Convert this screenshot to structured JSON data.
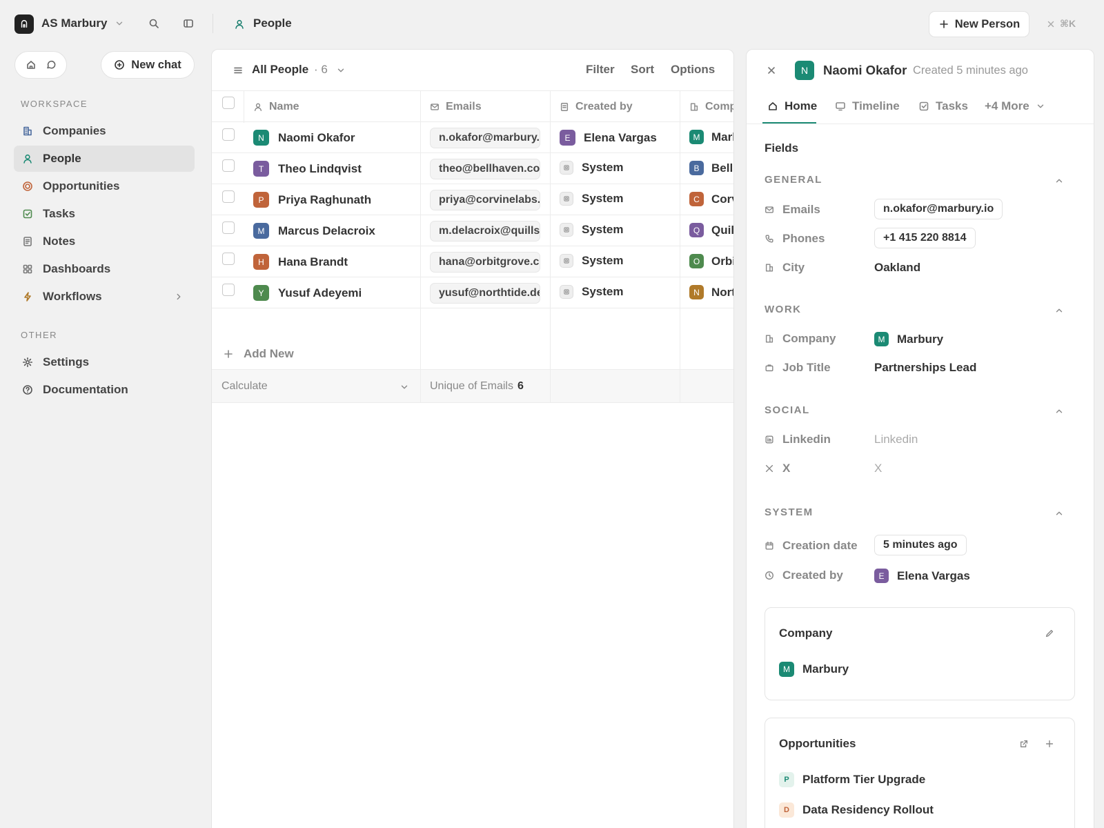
{
  "workspace": {
    "initials": "AS",
    "name": "AS Marbury"
  },
  "breadcrumb": {
    "label": "People"
  },
  "header": {
    "new_person_label": "New Person",
    "shortcut": "⌘K"
  },
  "sidebar": {
    "new_chat_label": "New chat",
    "workspace_section": "WORKSPACE",
    "other_section": "OTHER",
    "items": [
      {
        "label": "Companies",
        "icon": "building-icon"
      },
      {
        "label": "People",
        "icon": "person-icon",
        "active": true
      },
      {
        "label": "Opportunities",
        "icon": "target-icon"
      },
      {
        "label": "Tasks",
        "icon": "checkbox-icon"
      },
      {
        "label": "Notes",
        "icon": "note-icon"
      },
      {
        "label": "Dashboards",
        "icon": "grid-icon"
      },
      {
        "label": "Workflows",
        "icon": "lightning-icon"
      }
    ],
    "other_items": [
      {
        "label": "Settings",
        "icon": "gear-icon"
      },
      {
        "label": "Documentation",
        "icon": "help-icon"
      }
    ]
  },
  "view": {
    "name": "All People",
    "count": "· 6",
    "actions": {
      "filter": "Filter",
      "sort": "Sort",
      "options": "Options"
    }
  },
  "table": {
    "columns": {
      "name": "Name",
      "emails": "Emails",
      "created_by": "Created by",
      "company": "Comp"
    },
    "rows": [
      {
        "initial": "N",
        "color": "#1b8a74",
        "name": "Naomi Okafor",
        "email": "n.okafor@marbury.io",
        "by_initial": "E",
        "by_color": "#7a5c9e",
        "by": "Elena Vargas",
        "comp_initial": "M",
        "comp_color": "#1b8a74",
        "company": "Marl"
      },
      {
        "initial": "T",
        "color": "#7a5c9e",
        "name": "Theo Lindqvist",
        "email": "theo@bellhaven.co",
        "by_initial": "",
        "by_color": "",
        "by": "System",
        "comp_initial": "B",
        "comp_color": "#4a6a9e",
        "company": "Bellh"
      },
      {
        "initial": "P",
        "color": "#c0643a",
        "name": "Priya Raghunath",
        "email": "priya@corvinelabs.io",
        "by_initial": "",
        "by_color": "",
        "by": "System",
        "comp_initial": "C",
        "comp_color": "#c0643a",
        "company": "Corv"
      },
      {
        "initial": "M",
        "color": "#4a6a9e",
        "name": "Marcus Delacroix",
        "email": "m.delacroix@quillstone.com",
        "by_initial": "",
        "by_color": "",
        "by": "System",
        "comp_initial": "Q",
        "comp_color": "#7a5c9e",
        "company": "Quill"
      },
      {
        "initial": "H",
        "color": "#c0643a",
        "name": "Hana Brandt",
        "email": "hana@orbitgrove.co",
        "by_initial": "",
        "by_color": "",
        "by": "System",
        "comp_initial": "O",
        "comp_color": "#4e8a4e",
        "company": "Orbi"
      },
      {
        "initial": "Y",
        "color": "#4e8a4e",
        "name": "Yusuf Adeyemi",
        "email": "yusuf@northtide.dev",
        "by_initial": "",
        "by_color": "",
        "by": "System",
        "comp_initial": "N",
        "comp_color": "#b07a2a",
        "company": "Nort"
      }
    ],
    "add_new": "Add New",
    "calculate": "Calculate",
    "unique_label": "Unique of Emails",
    "unique_value": "6"
  },
  "detail": {
    "initial": "N",
    "name": "Naomi Okafor",
    "created": "Created 5 minutes ago",
    "tabs": {
      "home": "Home",
      "timeline": "Timeline",
      "tasks": "Tasks",
      "more": "+4 More"
    },
    "fields_title": "Fields",
    "groups": {
      "general": "GENERAL",
      "work": "WORK",
      "social": "SOCIAL",
      "system": "SYSTEM"
    },
    "labels": {
      "emails": "Emails",
      "phones": "Phones",
      "city": "City",
      "company": "Company",
      "job_title": "Job Title",
      "linkedin": "Linkedin",
      "x": "X",
      "creation_date": "Creation date",
      "created_by": "Created by"
    },
    "values": {
      "email": "n.okafor@marbury.io",
      "phone": "+1 415 220 8814",
      "city": "Oakland",
      "company_initial": "M",
      "company": "Marbury",
      "job_title": "Partnerships Lead",
      "linkedin": "Linkedin",
      "x": "X",
      "creation_date": "5 minutes ago",
      "created_by_initial": "E",
      "created_by": "Elena Vargas"
    },
    "company_card": {
      "title": "Company",
      "initial": "M",
      "name": "Marbury"
    },
    "opportunities_card": {
      "title": "Opportunities",
      "items": [
        {
          "initial": "P",
          "name": "Platform Tier Upgrade"
        },
        {
          "initial": "D",
          "name": "Data Residency Rollout"
        }
      ]
    }
  }
}
